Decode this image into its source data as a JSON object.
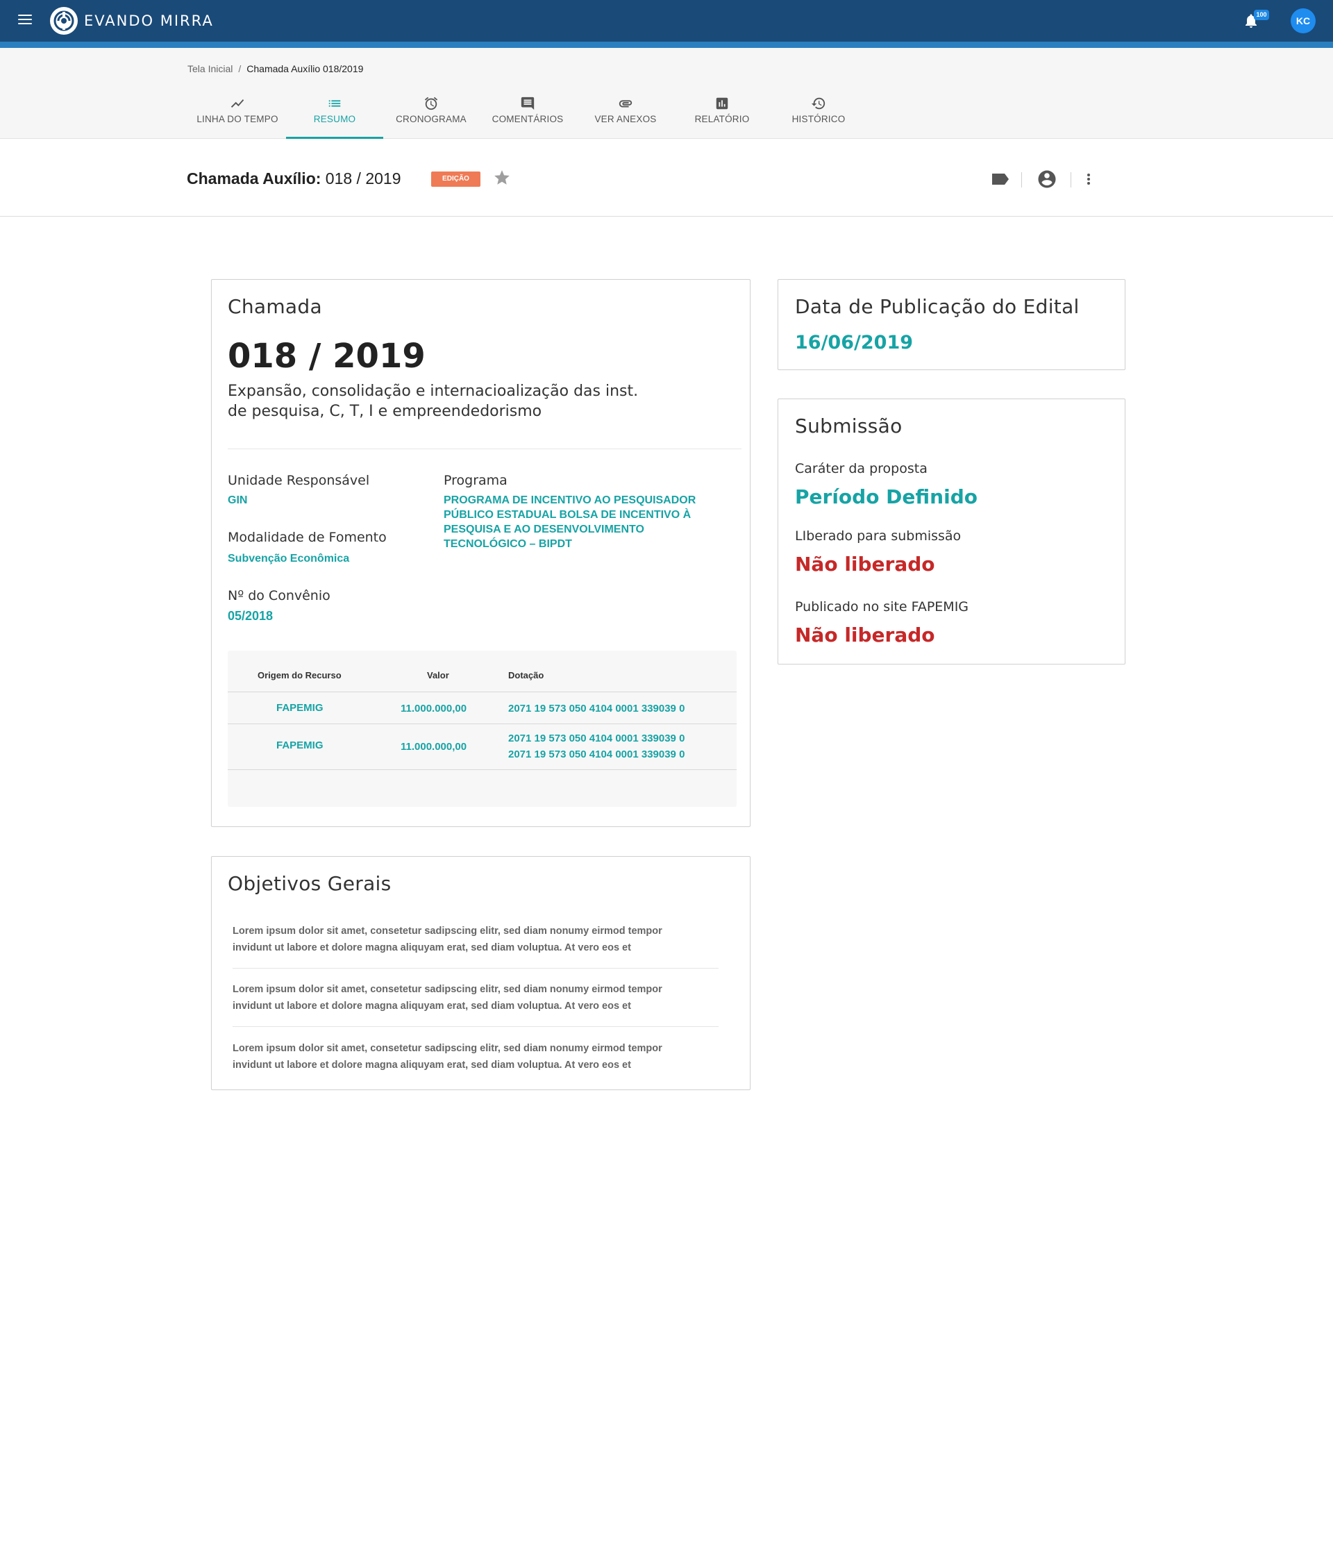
{
  "app": {
    "brand": "EVANDO MIRRA",
    "notifications_count": "100",
    "user_initials": "KC"
  },
  "breadcrumb": {
    "home": "Tela Inicial",
    "separator": "/",
    "current": "Chamada Auxílio 018/2019"
  },
  "tabs": [
    {
      "label": "LINHA DO TEMPO",
      "icon": "trending-icon"
    },
    {
      "label": "RESUMO",
      "icon": "list-icon",
      "active": true
    },
    {
      "label": "CRONOGRAMA",
      "icon": "alarm-icon"
    },
    {
      "label": "COMENTÁRIOS",
      "icon": "comment-icon"
    },
    {
      "label": "VER ANEXOS",
      "icon": "attachment-icon"
    },
    {
      "label": "RELATÓRIO",
      "icon": "report-icon"
    },
    {
      "label": "HISTÓRICO",
      "icon": "history-icon"
    }
  ],
  "header": {
    "title_bold": "Chamada Auxílio:",
    "title_rest": "018 / 2019",
    "status": "EDIÇÃO"
  },
  "chamada": {
    "title": "Chamada",
    "number": "018 / 2019",
    "description_line1": "Expansão, consolidação e internacioalização das inst.",
    "description_line2": "de pesquisa, C, T, I e empreendedorismo",
    "unidade_label": "Unidade Responsável",
    "unidade_value": "GIN",
    "modalidade_label": "Modalidade de Fomento",
    "modalidade_value": "Subvenção Econômica",
    "convenio_label": "Nº do Convênio",
    "convenio_value": "05/2018",
    "programa_label": "Programa",
    "programa_lines": [
      "PROGRAMA DE INCENTIVO AO PESQUISADOR",
      "PÚBLICO ESTADUAL BOLSA DE INCENTIVO À",
      "PESQUISA E AO DESENVOLVIMENTO",
      "TECNOLÓGICO – BIPDT"
    ],
    "table": {
      "headers": [
        "Origem do Recurso",
        "Valor",
        "Dotação"
      ],
      "rows": [
        {
          "origem": "FAPEMIG",
          "valor": "11.000.000,00",
          "dotacao": [
            "2071 19 573 050 4104 0001 339039 0"
          ]
        },
        {
          "origem": "FAPEMIG",
          "valor": "11.000.000,00",
          "dotacao": [
            "2071 19 573 050 4104 0001 339039 0",
            "2071 19 573 050 4104 0001 339039 0"
          ]
        }
      ]
    }
  },
  "objetivos": {
    "title": "Objetivos Gerais",
    "items": [
      {
        "line1": "Lorem ipsum dolor sit amet, consetetur sadipscing elitr, sed diam nonumy eirmod tempor",
        "line2": "invidunt ut labore et dolore magna aliquyam erat, sed diam voluptua. At vero eos et"
      },
      {
        "line1": "Lorem ipsum dolor sit amet, consetetur sadipscing elitr, sed diam nonumy eirmod tempor",
        "line2": "invidunt ut labore et dolore magna aliquyam erat, sed diam voluptua. At vero eos et"
      },
      {
        "line1": "Lorem ipsum dolor sit amet, consetetur sadipscing elitr, sed diam nonumy eirmod tempor",
        "line2": "invidunt ut labore et dolore magna aliquyam erat, sed diam voluptua. At vero eos et"
      }
    ]
  },
  "publicacao": {
    "title": "Data de Publicação do Edital",
    "date": "16/06/2019"
  },
  "submissao": {
    "title": "Submissão",
    "carater_label": "Caráter da proposta",
    "carater_value": "Período Definido",
    "liberado_label": "LIberado para submissão",
    "liberado_value": "Não liberado",
    "publicado_label": "Publicado no site FAPEMIG",
    "publicado_value": "Não liberado"
  },
  "colors": {
    "appbar": "#1a4a78",
    "accent_teal": "#17a3a5",
    "status_orange": "#ee7b55",
    "alert_red": "#c62828"
  }
}
